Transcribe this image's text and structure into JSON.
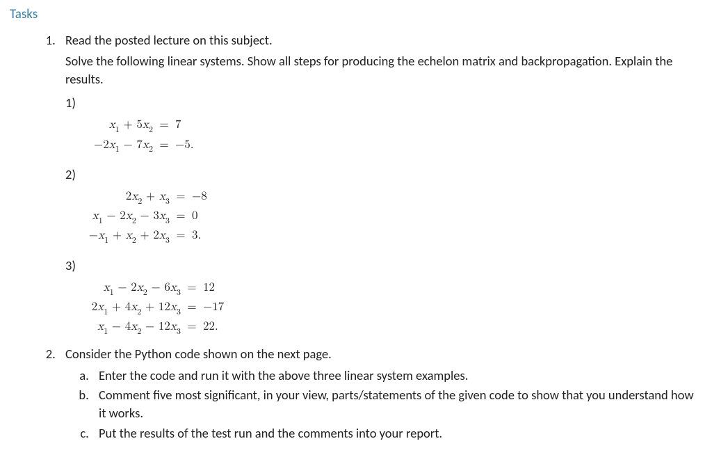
{
  "heading": "Tasks",
  "task1": {
    "intro_line1": "Read the posted lecture on this subject.",
    "intro_line2": "Solve the following linear systems. Show all steps for producing the echelon matrix and backpropagation. Explain the results.",
    "p1_label": "1)",
    "p2_label": "2)",
    "p3_label": "3)",
    "sys1": {
      "rows": [
        {
          "lhs_html": "<span class='v'>x</span><sub>1</sub> + 5<span class='v'>x</span><sub>2</sub>",
          "rhs": "7"
        },
        {
          "lhs_html": "−2<span class='v'>x</span><sub>1</sub> − 7<span class='v'>x</span><sub>2</sub>",
          "rhs": "−5."
        }
      ],
      "lhs_width": 108
    },
    "sys2": {
      "rows": [
        {
          "lhs_html": "2<span class='v'>x</span><sub>2</sub> + <span class='v'>x</span><sub>3</sub>",
          "rhs": "−8"
        },
        {
          "lhs_html": "<span class='v'>x</span><sub>1</sub> − 2<span class='v'>x</span><sub>2</sub> − 3<span class='v'>x</span><sub>3</sub>",
          "rhs": "0"
        },
        {
          "lhs_html": "−<span class='v'>x</span><sub>1</sub> + <span class='v'>x</span><sub>2</sub> + 2<span class='v'>x</span><sub>3</sub>",
          "rhs": "3."
        }
      ],
      "lhs_width": 132
    },
    "sys3": {
      "rows": [
        {
          "lhs_html": "<span class='v'>x</span><sub>1</sub> − 2<span class='v'>x</span><sub>2</sub> − 6<span class='v'>x</span><sub>3</sub>",
          "rhs": "12"
        },
        {
          "lhs_html": "2<span class='v'>x</span><sub>1</sub> + 4<span class='v'>x</span><sub>2</sub> + 12<span class='v'>x</span><sub>3</sub>",
          "rhs": "−17"
        },
        {
          "lhs_html": "<span class='v'>x</span><sub>1</sub> − 4<span class='v'>x</span><sub>2</sub> − 12<span class='v'>x</span><sub>3</sub>",
          "rhs": "22."
        }
      ],
      "lhs_width": 148
    }
  },
  "task2": {
    "intro": "Consider the Python code shown on the next page.",
    "a": "Enter the code and run it with the above three linear system examples.",
    "b": "Comment five most significant, in your view, parts/statements of the given code to show that you understand how it works.",
    "c": "Put the results of the test run and the comments into your report."
  }
}
